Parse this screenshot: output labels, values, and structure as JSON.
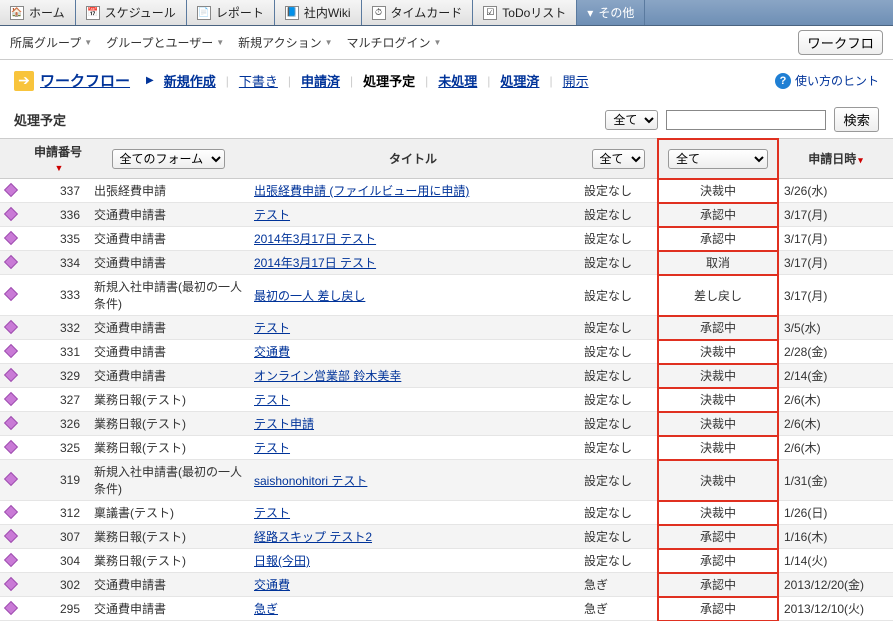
{
  "topnav": [
    {
      "label": "ホーム",
      "icon": "🏠"
    },
    {
      "label": "スケジュール",
      "icon": "📅"
    },
    {
      "label": "レポート",
      "icon": "📄"
    },
    {
      "label": "社内Wiki",
      "icon": "📘"
    },
    {
      "label": "タイムカード",
      "icon": "⏱"
    },
    {
      "label": "ToDoリスト",
      "icon": "☑"
    },
    {
      "label": "その他",
      "icon": "▾",
      "other": true
    }
  ],
  "subbar": {
    "items": [
      "所属グループ",
      "グループとユーザー",
      "新規アクション",
      "マルチログイン"
    ],
    "right_btn": "ワークフロ"
  },
  "workflow": {
    "title": "ワークフロー",
    "menu": [
      {
        "label": "新規作成",
        "bold": true
      },
      {
        "label": "下書き"
      },
      {
        "label": "申請済",
        "bold": true
      },
      {
        "label": "処理予定",
        "current": true
      },
      {
        "label": "未処理",
        "bold": true
      },
      {
        "label": "処理済",
        "bold": true
      },
      {
        "label": "開示"
      }
    ],
    "hint": "使い方のヒント"
  },
  "filter": {
    "heading": "処理予定",
    "top_select": "全て",
    "search_btn": "検索"
  },
  "columns": {
    "num": "申請番号",
    "form_select": "全てのフォーム",
    "title": "タイトル",
    "set_select": "全て",
    "status_select": "全て",
    "date": "申請日時"
  },
  "rows": [
    {
      "num": "337",
      "form": "出張経費申請",
      "title": "出張経費申請 (ファイルビュー用に申請)",
      "set": "設定なし",
      "status": "決裁中",
      "date": "3/26(水)"
    },
    {
      "num": "336",
      "form": "交通費申請書",
      "title": "テスト",
      "set": "設定なし",
      "status": "承認中",
      "date": "3/17(月)"
    },
    {
      "num": "335",
      "form": "交通費申請書",
      "title": "2014年3月17日 テスト",
      "set": "設定なし",
      "status": "承認中",
      "date": "3/17(月)"
    },
    {
      "num": "334",
      "form": "交通費申請書",
      "title": "2014年3月17日 テスト",
      "set": "設定なし",
      "status": "取消",
      "date": "3/17(月)"
    },
    {
      "num": "333",
      "form": "新規入社申請書(最初の一人条件)",
      "title": "最初の一人 差し戻し",
      "set": "設定なし",
      "status": "差し戻し",
      "date": "3/17(月)"
    },
    {
      "num": "332",
      "form": "交通費申請書",
      "title": "テスト",
      "set": "設定なし",
      "status": "承認中",
      "date": "3/5(水)"
    },
    {
      "num": "331",
      "form": "交通費申請書",
      "title": "交通費",
      "set": "設定なし",
      "status": "決裁中",
      "date": "2/28(金)"
    },
    {
      "num": "329",
      "form": "交通費申請書",
      "title": "オンライン営業部 鈴木美幸",
      "set": "設定なし",
      "status": "決裁中",
      "date": "2/14(金)"
    },
    {
      "num": "327",
      "form": "業務日報(テスト)",
      "title": "テスト",
      "set": "設定なし",
      "status": "決裁中",
      "date": "2/6(木)"
    },
    {
      "num": "326",
      "form": "業務日報(テスト)",
      "title": "テスト申請",
      "set": "設定なし",
      "status": "決裁中",
      "date": "2/6(木)"
    },
    {
      "num": "325",
      "form": "業務日報(テスト)",
      "title": "テスト",
      "set": "設定なし",
      "status": "決裁中",
      "date": "2/6(木)"
    },
    {
      "num": "319",
      "form": "新規入社申請書(最初の一人条件)",
      "title": "saishonohitori テスト",
      "set": "設定なし",
      "status": "決裁中",
      "date": "1/31(金)"
    },
    {
      "num": "312",
      "form": "稟議書(テスト)",
      "title": "テスト",
      "set": "設定なし",
      "status": "決裁中",
      "date": "1/26(日)"
    },
    {
      "num": "307",
      "form": "業務日報(テスト)",
      "title": "経路スキップ テスト2",
      "set": "設定なし",
      "status": "承認中",
      "date": "1/16(木)"
    },
    {
      "num": "304",
      "form": "業務日報(テスト)",
      "title": "日報(今田)",
      "set": "設定なし",
      "status": "承認中",
      "date": "1/14(火)"
    },
    {
      "num": "302",
      "form": "交通費申請書",
      "title": "交通費",
      "set": "急ぎ",
      "status": "承認中",
      "date": "2013/12/20(金)"
    },
    {
      "num": "295",
      "form": "交通費申請書",
      "title": "急ぎ",
      "set": "急ぎ",
      "status": "承認中",
      "date": "2013/12/10(火)"
    }
  ]
}
